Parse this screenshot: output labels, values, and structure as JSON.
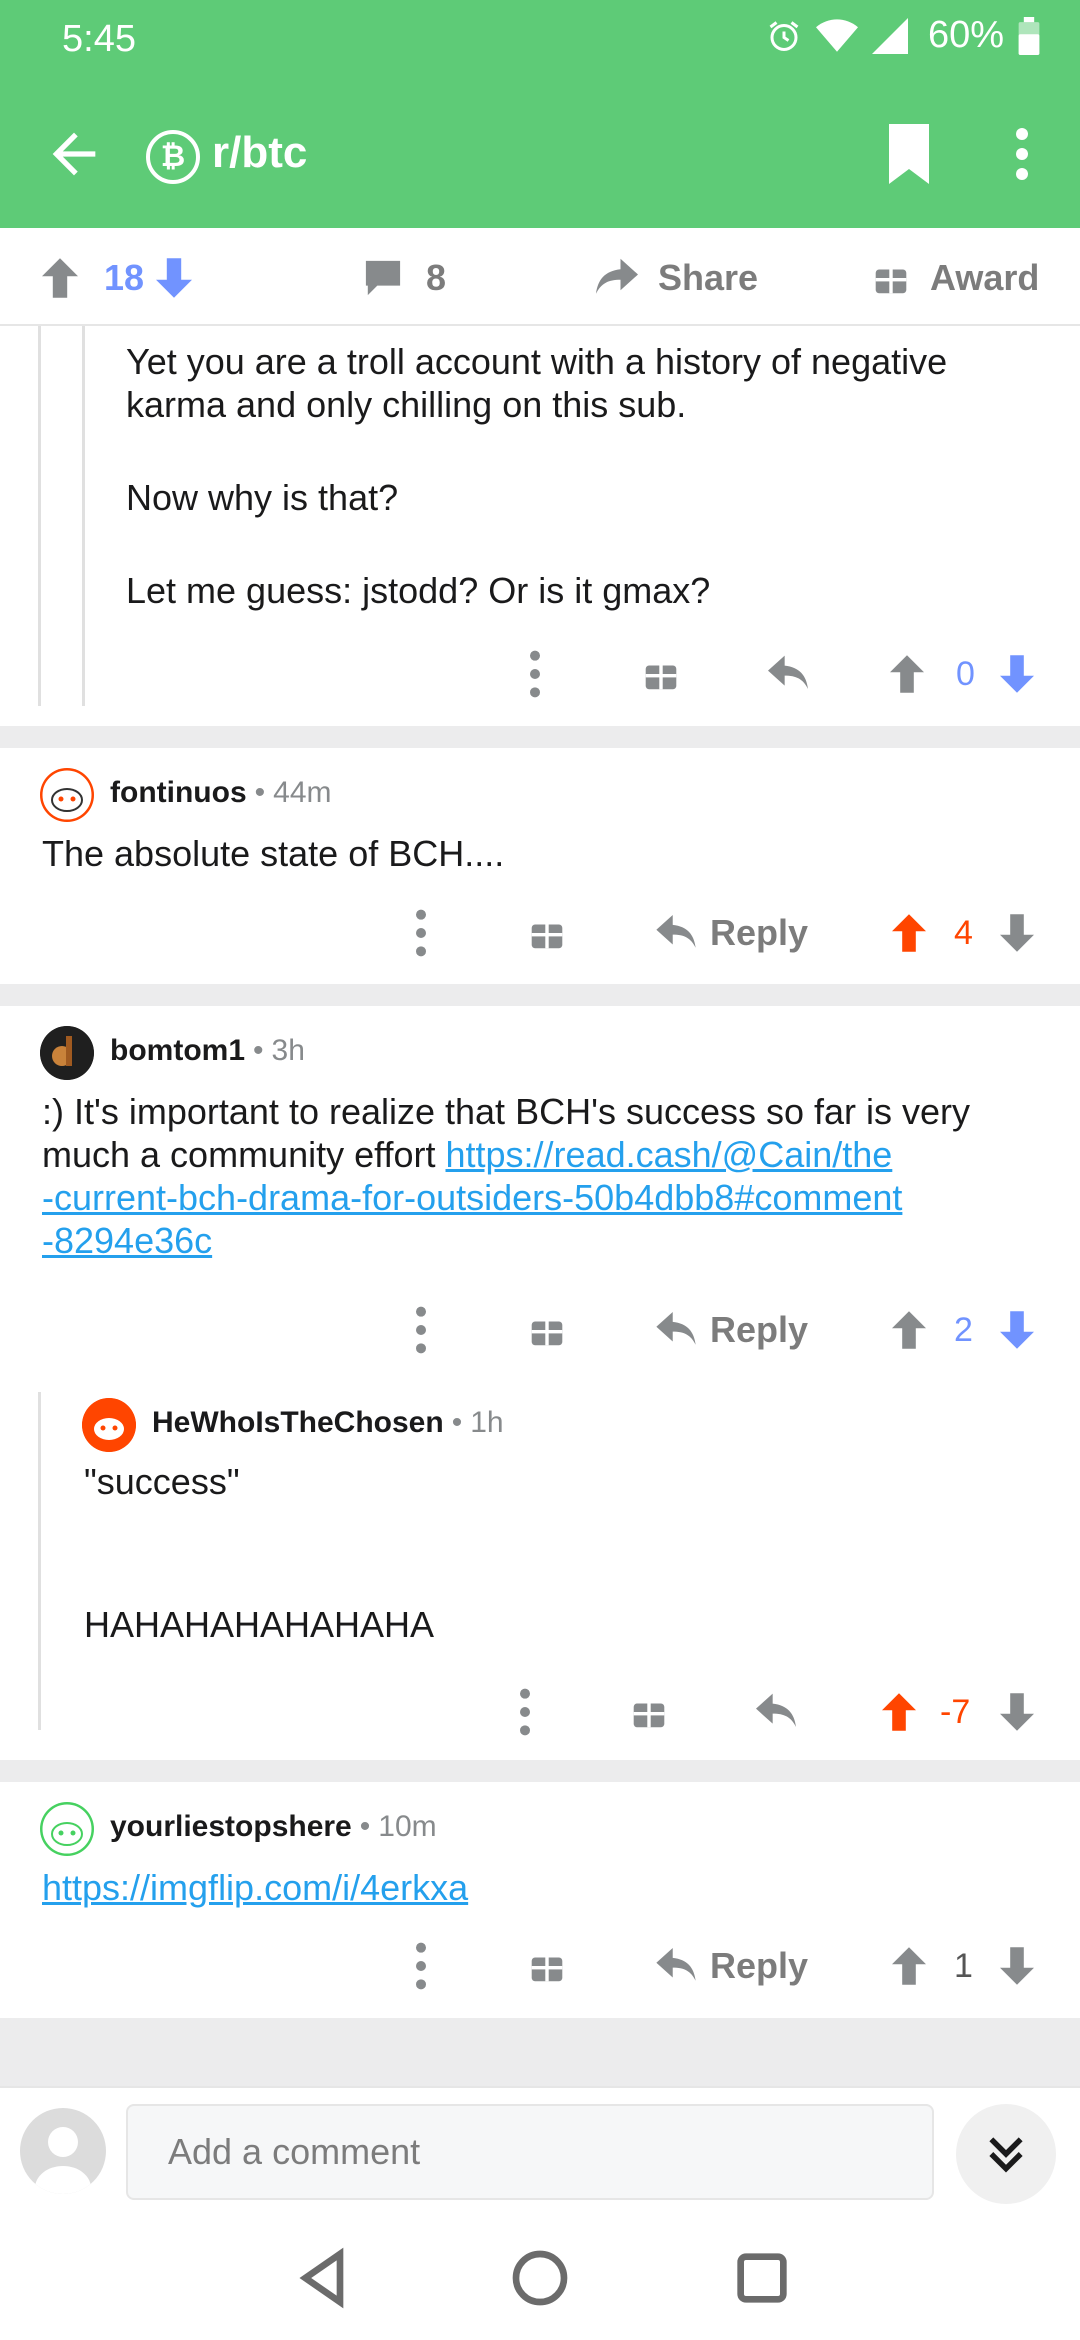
{
  "status_bar": {
    "time": "5:45",
    "battery": "60%"
  },
  "app_bar": {
    "subreddit": "r/btc",
    "sub_icon": "₿"
  },
  "post_bar": {
    "score": "18",
    "comments": "8",
    "share_label": "Share",
    "award_label": "Award"
  },
  "comments": [
    {
      "body_lines": [
        "Yet you are a troll account with a history of negative karma and only chilling on this sub.",
        "Now why is that?",
        "Let me guess: jstodd? Or is it gmax?"
      ],
      "score": "0"
    },
    {
      "user": "fontinuos",
      "time": "44m",
      "body": "The absolute state of BCH....",
      "reply_label": "Reply",
      "score": "4"
    },
    {
      "user": "bomtom1",
      "time": "3h",
      "body": ":) It's important to realize that BCH's success so far is very much a community effort ",
      "link": "https://read.cash/@Cain/the-current-bch-drama-for-outsiders-50b4dbb8#comment-8294e36c",
      "link_lines": [
        "https://read.cash/@Cain/the",
        "-current-bch-drama-for-outsiders-50b4dbb8#comment",
        "-8294e36c"
      ],
      "reply_label": "Reply",
      "score": "2"
    },
    {
      "user": "HeWhoIsTheChosen",
      "time": "1h",
      "body_lines": [
        "\"success\"",
        "HAHAHAHAHAHAHA"
      ],
      "score": "-7"
    },
    {
      "user": "yourliestopshere",
      "time": "10m",
      "link": "https://imgflip.com/i/4erkxa",
      "reply_label": "Reply",
      "score": "1"
    }
  ],
  "input": {
    "placeholder": "Add a comment"
  },
  "colors": {
    "header": "#5ecb77",
    "upvote": "#ff4500",
    "downvote": "#7193ff",
    "link": "#24a0ed"
  }
}
